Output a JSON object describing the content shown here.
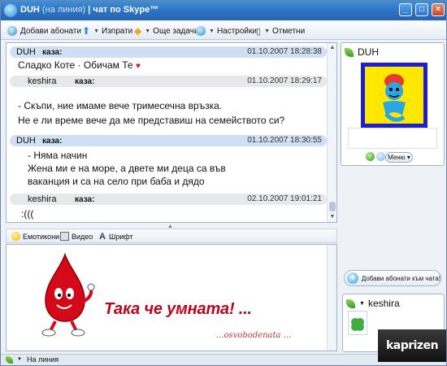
{
  "window": {
    "title_main": "DUH",
    "title_status": "(на линия)",
    "title_suffix": "| чат по Skype™"
  },
  "toolbar": {
    "add_contacts": "Добави абонати",
    "send": "Изпрати",
    "more_tasks": "Още задачи",
    "settings": "Настройки",
    "mark": "Отметни"
  },
  "chat": {
    "messages": [
      {
        "sender": "DUH",
        "says": "каза:",
        "time": "01.10.2007 18:28:38",
        "lines": [
          "Сладко Коте · Обичам Те"
        ]
      },
      {
        "sender": "keshira",
        "says": "каза:",
        "time": "01.10.2007 18:29:17",
        "lines": [
          "- Скъпи, ние имаме вече тримесечна връзка.",
          "Не е ли време вече да ме представиш на семейството си?"
        ]
      },
      {
        "sender": "DUH",
        "says": "каза:",
        "time": "01.10.2007 18:30:55",
        "lines": [
          "- Няма начин",
          "Жена ми е на море, а двете ми деца са във",
          "ваканция и са на село при баба и дядо"
        ]
      },
      {
        "sender": "keshira",
        "says": "каза:",
        "time": "02.10.2007 19:01:21",
        "lines": [
          ":((("
        ]
      }
    ]
  },
  "input_bar": {
    "emoticons": "Емотикони",
    "video": "Видео",
    "font": "Шрифт"
  },
  "input": {
    "big_text": "Така че умната! ...",
    "signature": "...osvobodenata ..."
  },
  "contact": {
    "name": "DUH",
    "menu": "Меню"
  },
  "add_to_chat": "Добави абонати към чата!",
  "self_contact": {
    "name": "keshira"
  },
  "status": {
    "text": "На линия"
  },
  "watermark": "kaprizen",
  "colors": {
    "accent": "#2b6fc0",
    "header_blue": "#cfe0f4",
    "header_grey": "#e6e8ec",
    "big_text": "#b8061e"
  }
}
